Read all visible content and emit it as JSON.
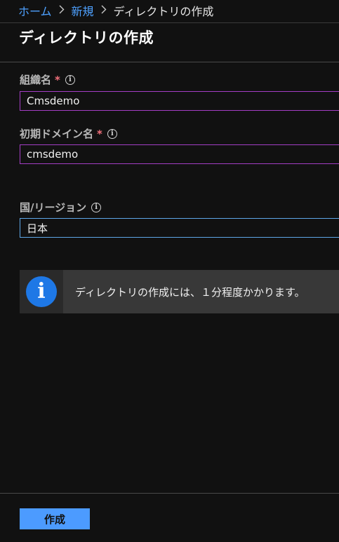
{
  "breadcrumb": {
    "items": [
      "ホーム",
      "新規",
      "ディレクトリの作成"
    ],
    "separator_icon": "chevron-right-icon"
  },
  "page": {
    "title": "ディレクトリの作成"
  },
  "form": {
    "organization_name": {
      "label": "組織名",
      "required": "*",
      "info_icon": "info-icon",
      "value": "Cmsdemo"
    },
    "initial_domain": {
      "label": "初期ドメイン名",
      "required": "*",
      "info_icon": "info-icon",
      "value": "cmsdemo"
    },
    "country_region": {
      "label": "国/リージョン",
      "info_icon": "info-icon",
      "value": "日本"
    }
  },
  "notice": {
    "icon": "info-circle-icon",
    "text": "ディレクトリの作成には、１分程度かかります。"
  },
  "footer": {
    "create_label": "作成"
  },
  "colors": {
    "background": "#111111",
    "link": "#4ea1ff",
    "required": "#f1707b",
    "input_border": "#a43ec5",
    "select_border": "#5ea7e8",
    "info_icon": "#1e78e6",
    "primary_button": "#4c9bff"
  }
}
